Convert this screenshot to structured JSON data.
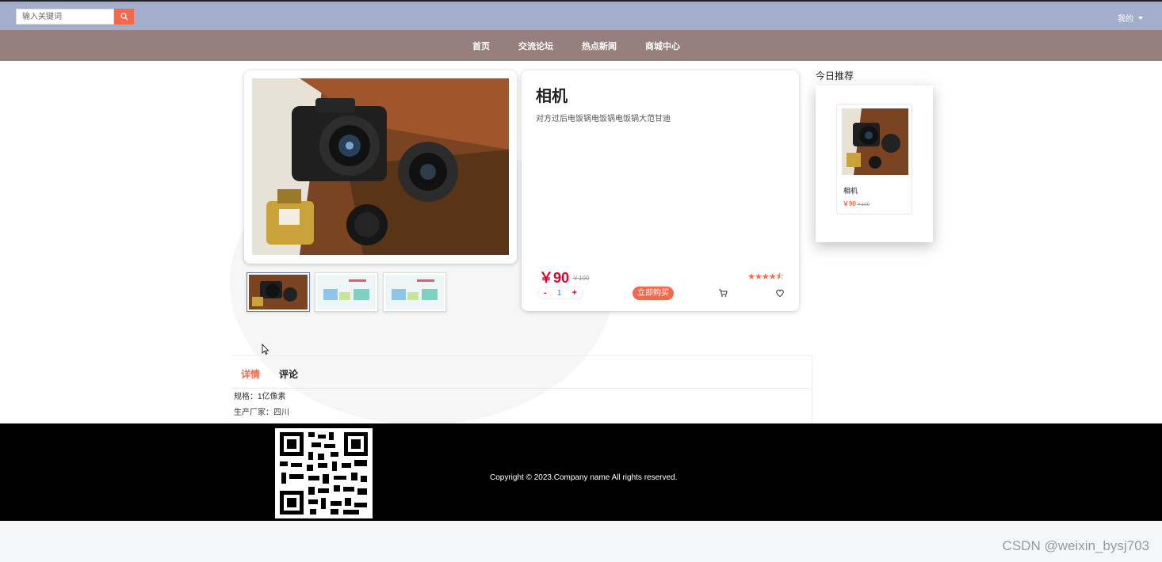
{
  "header": {
    "search_placeholder": "输入关键词",
    "user_menu_label": "我的"
  },
  "nav": {
    "items": [
      "首页",
      "交流论坛",
      "热点新闻",
      "商城中心"
    ]
  },
  "product": {
    "title": "相机",
    "description": "对方过后电饭锅电饭锅电饭锅大范甘迪",
    "price": "￥90",
    "original_price": "￥100",
    "rating": 4.5,
    "quantity": "1",
    "minus_label": "-",
    "plus_label": "+",
    "buy_label": "立即购买",
    "cart_icon": "cart-icon",
    "favorite_icon": "heart-icon"
  },
  "recommend": {
    "title": "今日推荐",
    "items": [
      {
        "name": "相机",
        "price": "￥90",
        "original_price": "￥100"
      }
    ]
  },
  "detail": {
    "tabs": [
      "详情",
      "评论"
    ],
    "active_tab": 0,
    "specs": [
      "规格：1亿像素",
      "生产厂家：四川"
    ]
  },
  "footer": {
    "copyright": "Copyright © 2023.Company name All rights reserved."
  },
  "watermark": "CSDN @weixin_bysj703",
  "colors": {
    "topbar": "#a2aecb",
    "navbar": "#967f7c",
    "accent": "#f06a4b",
    "price": "#e4002b"
  }
}
